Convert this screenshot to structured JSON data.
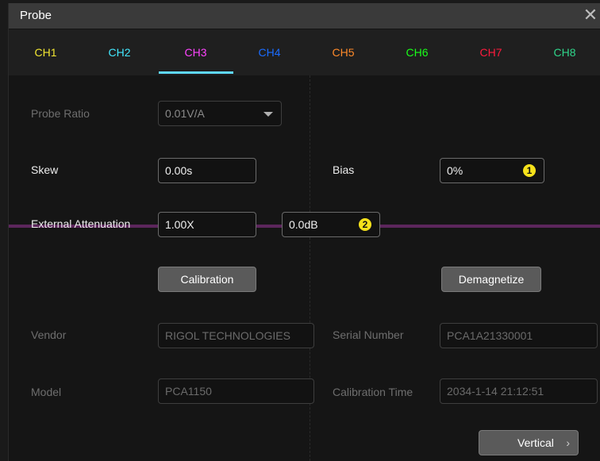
{
  "window": {
    "title": "Probe",
    "close_glyph": "✕"
  },
  "tabs": [
    {
      "label": "CH1",
      "color": "#f2e632"
    },
    {
      "label": "CH2",
      "color": "#42e8ff"
    },
    {
      "label": "CH3",
      "color": "#ff44ff"
    },
    {
      "label": "CH4",
      "color": "#1b6cff"
    },
    {
      "label": "CH5",
      "color": "#ff8a2a"
    },
    {
      "label": "CH6",
      "color": "#19ff19"
    },
    {
      "label": "CH7",
      "color": "#ff1a3c"
    },
    {
      "label": "CH8",
      "color": "#2fd58a"
    }
  ],
  "active_tab": "CH3",
  "form": {
    "probe_ratio_label": "Probe Ratio",
    "probe_ratio_value": "0.01V/A",
    "skew_label": "Skew",
    "skew_value": "0.00s",
    "bias_label": "Bias",
    "bias_value": "0%",
    "bias_badge": "1",
    "ext_atten_label": "External Attenuation",
    "ext_atten_value": "1.00X",
    "ext_atten_db_value": "0.0dB",
    "ext_atten_badge": "2",
    "calibration_button": "Calibration",
    "demagnetize_button": "Demagnetize",
    "vendor_label": "Vendor",
    "vendor_value": "RIGOL TECHNOLOGIES",
    "serial_label": "Serial Number",
    "serial_value": "PCA1A21330001",
    "model_label": "Model",
    "model_value": "PCA1150",
    "cal_time_label": "Calibration Time",
    "cal_time_value": "2034-1-14 21:12:51",
    "vertical_button": "Vertical",
    "vertical_chevron": "›"
  },
  "colors": {
    "badge": "#f5e11b",
    "trace": "#7a2d7a",
    "tab_underline": "#5fd8ff"
  }
}
